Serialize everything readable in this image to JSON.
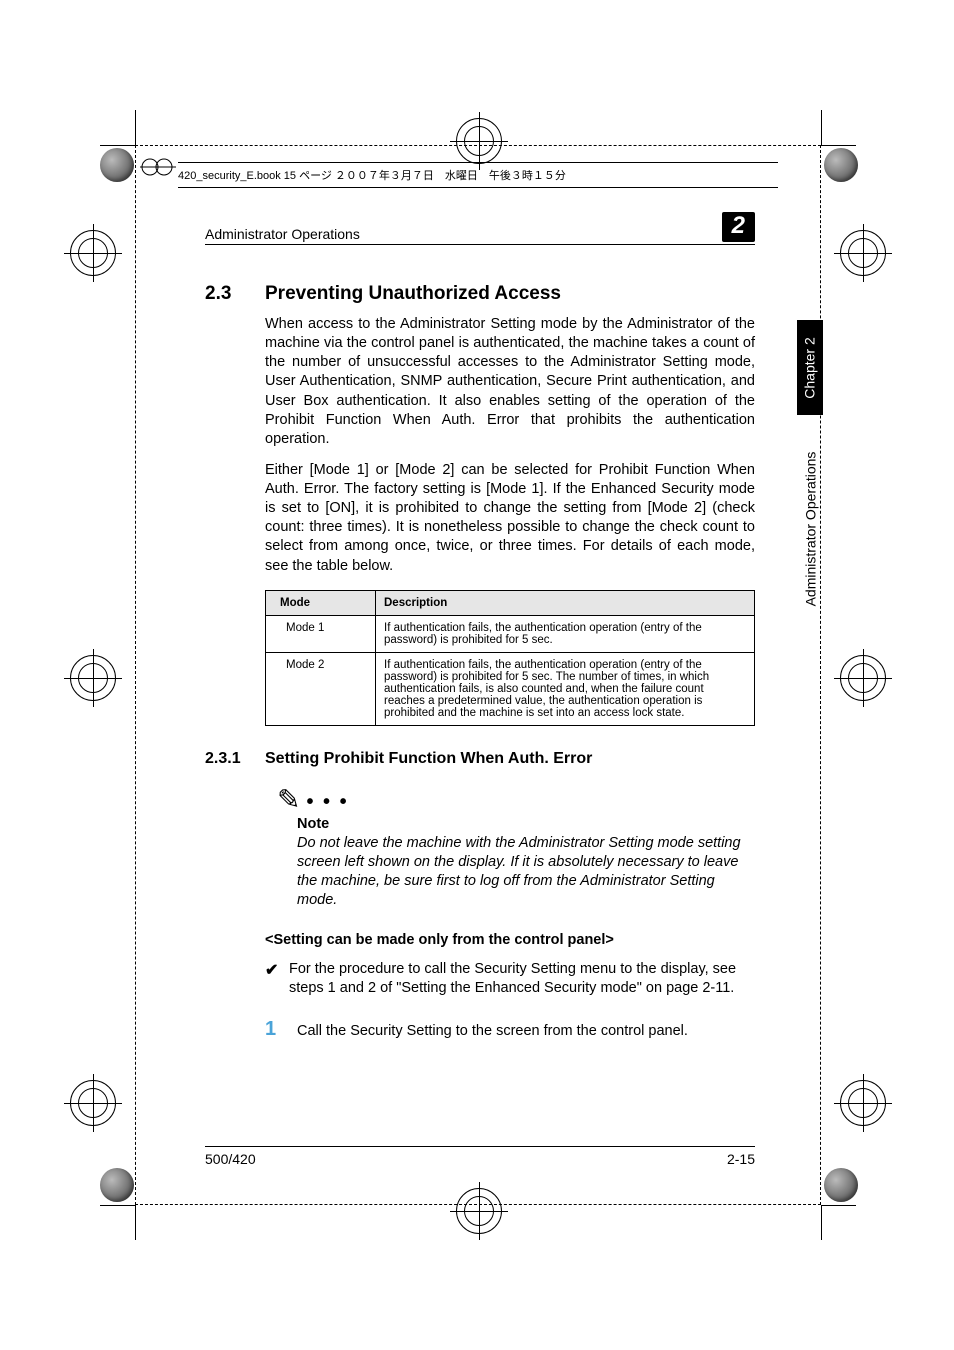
{
  "printinfo": "420_security_E.book  15 ページ  ２００７年３月７日　水曜日　午後３時１５分",
  "running_header": {
    "title": "Administrator Operations",
    "chapter_num": "2"
  },
  "side": {
    "chapter_label": "Chapter 2",
    "section_label": "Administrator Operations"
  },
  "h2": {
    "num": "2.3",
    "title": "Preventing Unauthorized Access"
  },
  "para1": "When access to the Administrator Setting mode by the Administrator of the machine via the control panel is authenticated, the machine takes a count of the number of unsuccessful accesses to the Administrator Setting mode, User Authentication, SNMP authentication, Secure Print authentication, and User Box authentication. It also enables setting of the operation of the Prohibit Function When Auth. Error that prohibits the authentication operation.",
  "para2": "Either [Mode 1] or [Mode 2] can be selected for Prohibit Function When Auth. Error. The factory setting is [Mode 1]. If the Enhanced Security mode is set to [ON], it is prohibited to change the setting from [Mode 2] (check count: three times). It is nonetheless possible to change the check count to select from among once, twice, or three times. For details of each mode, see the table below.",
  "table": {
    "head_mode": "Mode",
    "head_desc": "Description",
    "rows": [
      {
        "mode": "Mode 1",
        "desc": "If authentication fails, the authentication operation (entry of the password) is prohibited for 5 sec."
      },
      {
        "mode": "Mode 2",
        "desc": "If authentication fails, the authentication operation (entry of the password) is prohibited for 5 sec. The number of times, in which authentication fails, is also counted and, when the failure count reaches a predetermined value, the authentication operation is prohibited and the machine is set into an access lock state."
      }
    ]
  },
  "h3": {
    "num": "2.3.1",
    "title": "Setting Prohibit Function When Auth. Error"
  },
  "note": {
    "label": "Note",
    "body": "Do not leave the machine with the Administrator Setting mode setting screen left shown on the display. If it is absolutely necessary to leave the machine, be sure first to log off from the Administrator Setting mode."
  },
  "subhead": "<Setting can be made only from the control panel>",
  "checkitem": "For the procedure to call the Security Setting menu to the display, see steps 1 and 2 of \"Setting the Enhanced Security mode\" on page 2-11.",
  "step1": {
    "num": "1",
    "text": "Call the Security Setting to the screen from the control panel."
  },
  "footer": {
    "left": "500/420",
    "right": "2-15"
  }
}
